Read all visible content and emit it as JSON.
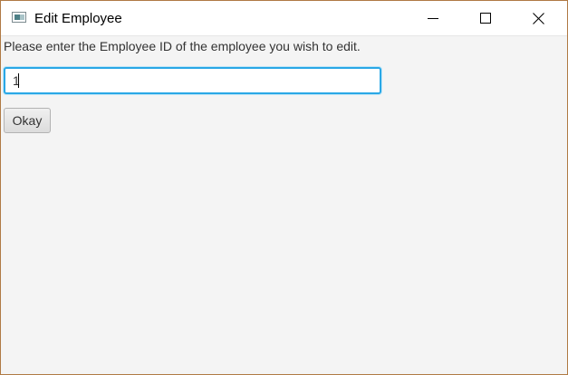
{
  "window": {
    "title": "Edit Employee",
    "icon": "app-window-icon",
    "controls": {
      "minimize_icon": "minimize-icon",
      "maximize_icon": "maximize-icon",
      "close_icon": "close-icon"
    }
  },
  "form": {
    "prompt": "Please enter the Employee ID of the employee you wish to edit.",
    "employee_id_value": "1",
    "okay_label": "Okay"
  },
  "colors": {
    "focus_border": "#2aa7e6",
    "window_border": "#b07a44",
    "background": "#f4f4f4"
  }
}
